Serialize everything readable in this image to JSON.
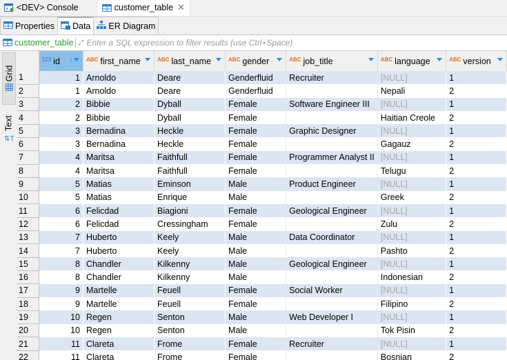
{
  "editor_tabs": [
    {
      "label": "<DEV> Console",
      "icon": "console-icon",
      "active": false
    },
    {
      "label": "customer_table",
      "icon": "table-icon",
      "active": true,
      "closable": true
    }
  ],
  "sub_tabs": [
    {
      "label": "Properties",
      "icon": "table-icon"
    },
    {
      "label": "Data",
      "icon": "data-icon",
      "active": true
    },
    {
      "label": "ER Diagram",
      "icon": "er-diagram-icon"
    }
  ],
  "filter": {
    "table_name": "customer_table",
    "placeholder": "Enter a SQL expression to filter results (use Ctrl+Space)"
  },
  "side_tabs": [
    {
      "label": "Grid",
      "icon": "grid-icon",
      "active": true
    },
    {
      "label": "Text",
      "icon": "text-icon"
    }
  ],
  "table": {
    "columns": [
      {
        "name": "id",
        "type": "123",
        "sorted": true
      },
      {
        "name": "first_name",
        "type": "ABC"
      },
      {
        "name": "last_name",
        "type": "ABC"
      },
      {
        "name": "gender",
        "type": "ABC"
      },
      {
        "name": "job_title",
        "type": "ABC"
      },
      {
        "name": "language",
        "type": "ABC"
      },
      {
        "name": "version",
        "type": "ABC"
      }
    ],
    "null_text": "[NULL]",
    "rows": [
      [
        "1",
        "1",
        "Arnoldo",
        "Deare",
        "Genderfluid",
        "Recruiter",
        null,
        "1"
      ],
      [
        "2",
        "1",
        "Arnoldo",
        "Deare",
        "Genderfluid",
        "",
        "Nepali",
        "2"
      ],
      [
        "3",
        "2",
        "Bibbie",
        "Dyball",
        "Female",
        "Software Engineer III",
        null,
        "1"
      ],
      [
        "4",
        "2",
        "Bibbie",
        "Dyball",
        "Female",
        "",
        "Haitian Creole",
        "2"
      ],
      [
        "5",
        "3",
        "Bernadina",
        "Heckle",
        "Female",
        "Graphic Designer",
        null,
        "1"
      ],
      [
        "6",
        "3",
        "Bernadina",
        "Heckle",
        "Female",
        "",
        "Gagauz",
        "2"
      ],
      [
        "7",
        "4",
        "Maritsa",
        "Faithfull",
        "Female",
        "Programmer Analyst II",
        null,
        "1"
      ],
      [
        "8",
        "4",
        "Maritsa",
        "Faithfull",
        "Female",
        "",
        "Telugu",
        "2"
      ],
      [
        "9",
        "5",
        "Matias",
        "Eminson",
        "Male",
        "Product Engineer",
        null,
        "1"
      ],
      [
        "10",
        "5",
        "Matias",
        "Enrique",
        "Male",
        "",
        "Greek",
        "2"
      ],
      [
        "11",
        "6",
        "Felicdad",
        "Biagioni",
        "Female",
        "Geological Engineer",
        null,
        "1"
      ],
      [
        "12",
        "6",
        "Felicdad",
        "Cressingham",
        "Female",
        "",
        "Zulu",
        "2"
      ],
      [
        "13",
        "7",
        "Huberto",
        "Keely",
        "Male",
        "Data Coordinator",
        null,
        "1"
      ],
      [
        "14",
        "7",
        "Huberto",
        "Keely",
        "Male",
        "",
        "Pashto",
        "2"
      ],
      [
        "15",
        "8",
        "Chandler",
        "Kilkenny",
        "Male",
        "Geological Engineer",
        null,
        "1"
      ],
      [
        "16",
        "8",
        "Chandler",
        "Kilkenny",
        "Male",
        "",
        "Indonesian",
        "2"
      ],
      [
        "17",
        "9",
        "Martelle",
        "Feuell",
        "Female",
        "Social Worker",
        null,
        "1"
      ],
      [
        "18",
        "9",
        "Martelle",
        "Feuell",
        "Female",
        "",
        "Filipino",
        "2"
      ],
      [
        "19",
        "10",
        "Regen",
        "Senton",
        "Male",
        "Web Developer I",
        null,
        "1"
      ],
      [
        "20",
        "10",
        "Regen",
        "Senton",
        "Male",
        "",
        "Tok Pisin",
        "2"
      ],
      [
        "21",
        "11",
        "Clareta",
        "Frome",
        "Female",
        "Recruiter",
        null,
        "1"
      ],
      [
        "22",
        "11",
        "Clareta",
        "Frome",
        "Female",
        "",
        "Bosnian",
        "2"
      ]
    ]
  }
}
